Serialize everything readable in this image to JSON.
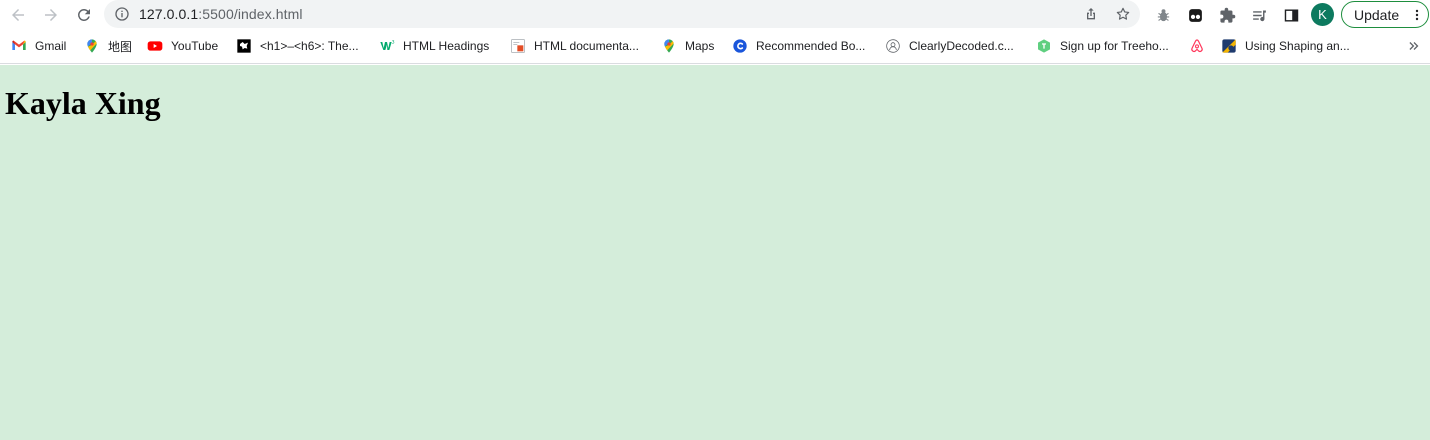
{
  "browser": {
    "address_bar": {
      "url_host": "127.0.0.1",
      "url_rest": ":5500/index.html"
    },
    "profile_initial": "K",
    "update_label": "Update"
  },
  "bookmarks": [
    {
      "label": "Gmail",
      "icon": "gmail-icon"
    },
    {
      "label": "地图",
      "icon": "google-maps-icon"
    },
    {
      "label": "YouTube",
      "icon": "youtube-icon"
    },
    {
      "label": "<h1>–<h6>: The...",
      "icon": "mdn-icon"
    },
    {
      "label": "HTML Headings",
      "icon": "w3schools-icon"
    },
    {
      "label": "HTML documenta...",
      "icon": "html-doc-icon"
    },
    {
      "label": "Maps",
      "icon": "google-maps-icon"
    },
    {
      "label": "Recommended Bo...",
      "icon": "recommended-icon"
    },
    {
      "label": "ClearlyDecoded.c...",
      "icon": "clearlydecoded-icon"
    },
    {
      "label": "Sign up for Treeho...",
      "icon": "treehouse-icon"
    },
    {
      "label": "",
      "icon": "airbnb-icon"
    },
    {
      "label": "Using Shaping an...",
      "icon": "shaping-icon"
    }
  ],
  "page": {
    "heading": "Kayla Xing",
    "background_color": "#d4edda"
  },
  "colors": {
    "update_border": "#1e8e3e",
    "avatar_bg": "#0d7a5f"
  }
}
